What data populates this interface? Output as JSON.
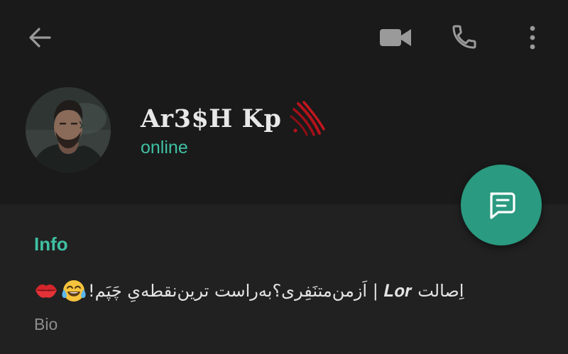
{
  "colors": {
    "header_bg": "#1a1a1a",
    "info_bg": "#212121",
    "accent": "#3fc0a2",
    "fab": "#2a9a80",
    "icon": "#9a9a9a",
    "text_primary": "#e8e8e8",
    "text_secondary": "#8e8e8e"
  },
  "toolbar": {
    "back_icon": "arrow-left-icon",
    "video_icon": "video-camera-icon",
    "call_icon": "phone-icon",
    "menu_icon": "more-vertical-icon"
  },
  "profile": {
    "name": "Ar3$H Kp",
    "name_decoration_icon": "claw-scratch-icon",
    "status": "online",
    "avatar_icon": "profile-photo"
  },
  "fab": {
    "icon": "message-icon"
  },
  "info": {
    "title": "Info",
    "bio_emojis": [
      "kiss-mark-icon",
      "tears-of-joy-icon"
    ],
    "bio_text": "اِصالت 𝑳𝒐𝒓 | اَزمن‌متنَفِری؟به‌راست ترین‌نقطه‌یِ چَپَم!",
    "bio_label": "Bio"
  }
}
